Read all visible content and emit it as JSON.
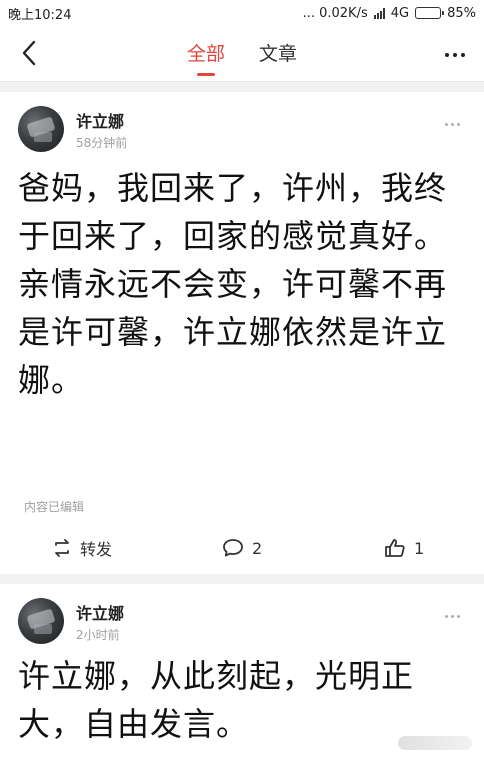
{
  "status_bar": {
    "time": "晚上10:24",
    "network_speed": "... 0.02K/s",
    "network_type": "4G",
    "battery": "85%",
    "battery_level": 0.85
  },
  "nav": {
    "tabs": [
      {
        "label": "全部",
        "active": true
      },
      {
        "label": "文章",
        "active": false
      }
    ]
  },
  "posts": [
    {
      "author": "许立娜",
      "time": "58分钟前",
      "content": "爸妈，我回来了，许州，我终于回来了，回家的感觉真好。亲情永远不会变，许可馨不再是许可馨，许立娜依然是许立娜。",
      "edited_note": "内容已编辑",
      "repost_label": "转发",
      "comment_count": "2",
      "like_count": "1"
    },
    {
      "author": "许立娜",
      "time": "2小时前",
      "content": "许立娜，从此刻起，光明正大，自由发言。"
    }
  ],
  "colors": {
    "accent": "#e2453b",
    "background": "#f1f1f1"
  }
}
